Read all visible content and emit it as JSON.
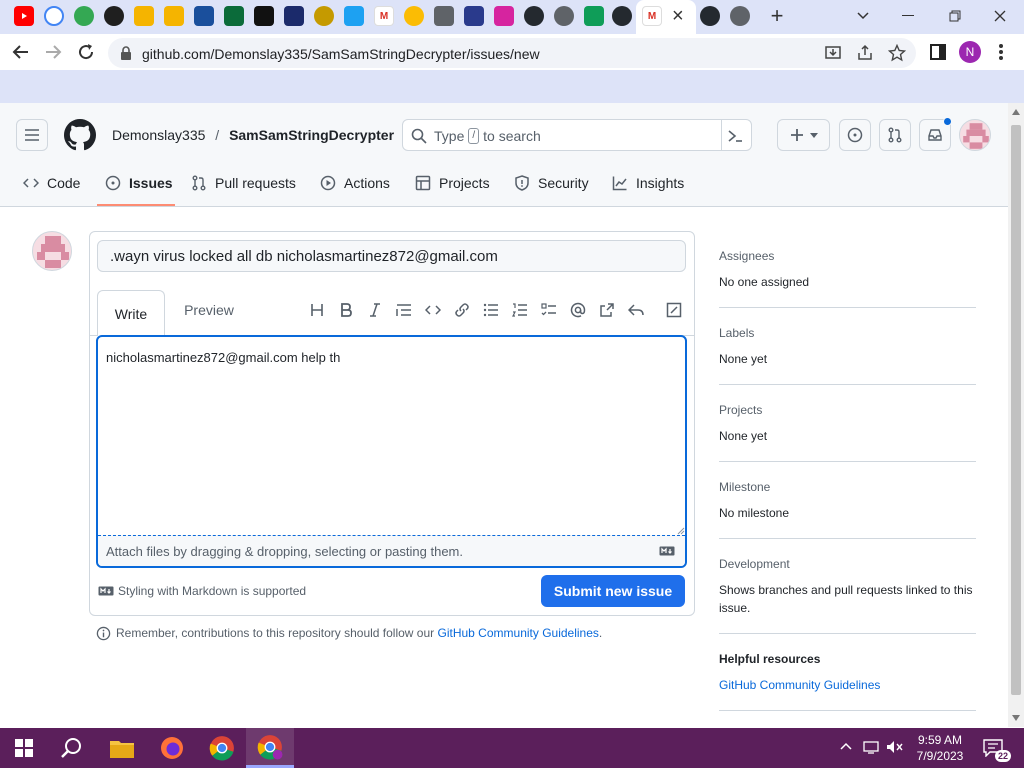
{
  "browser": {
    "url": "github.com/Demonslay335/SamSamStringDecrypter/issues/new",
    "tab_close": "×",
    "new_tab": "+",
    "profile_initial": "N"
  },
  "repo": {
    "owner": "Demonslay335",
    "separator": "/",
    "name": "SamSamStringDecrypter"
  },
  "search": {
    "prefix": "Type",
    "key": "/",
    "suffix": "to search"
  },
  "nav": {
    "items": [
      {
        "label": "Code"
      },
      {
        "label": "Issues"
      },
      {
        "label": "Pull requests"
      },
      {
        "label": "Actions"
      },
      {
        "label": "Projects"
      },
      {
        "label": "Security"
      },
      {
        "label": "Insights"
      }
    ]
  },
  "issue": {
    "title_value": ".wayn virus locked all db nicholasmartinez872@gmail.com",
    "write_tab": "Write",
    "preview_tab": "Preview",
    "body_text": "nicholasmartinez872@gmail.com help th",
    "attach_hint": "Attach files by dragging & dropping, selecting or pasting them.",
    "markdown_note": "Styling with Markdown is supported",
    "submit_label": "Submit new issue",
    "guidelines_prefix": "Remember, contributions to this repository should follow our",
    "guidelines_link": "GitHub Community Guidelines",
    "guidelines_suffix": "."
  },
  "sidebar": {
    "assignees": {
      "heading": "Assignees",
      "value": "No one assigned"
    },
    "labels": {
      "heading": "Labels",
      "value": "None yet"
    },
    "projects": {
      "heading": "Projects",
      "value": "None yet"
    },
    "milestone": {
      "heading": "Milestone",
      "value": "No milestone"
    },
    "development": {
      "heading": "Development",
      "value_line1": "Shows branches and pull requests linked to this",
      "value_line2": "issue."
    },
    "helpful": {
      "heading": "Helpful resources",
      "link": "GitHub Community Guidelines"
    }
  },
  "taskbar": {
    "time": "9:59 AM",
    "date": "7/9/2023"
  },
  "colors": {
    "accent": "#0969da",
    "submit": "#1f6feb",
    "taskbar": "#5b1f5b",
    "tabstrip": "#dde3f8"
  }
}
